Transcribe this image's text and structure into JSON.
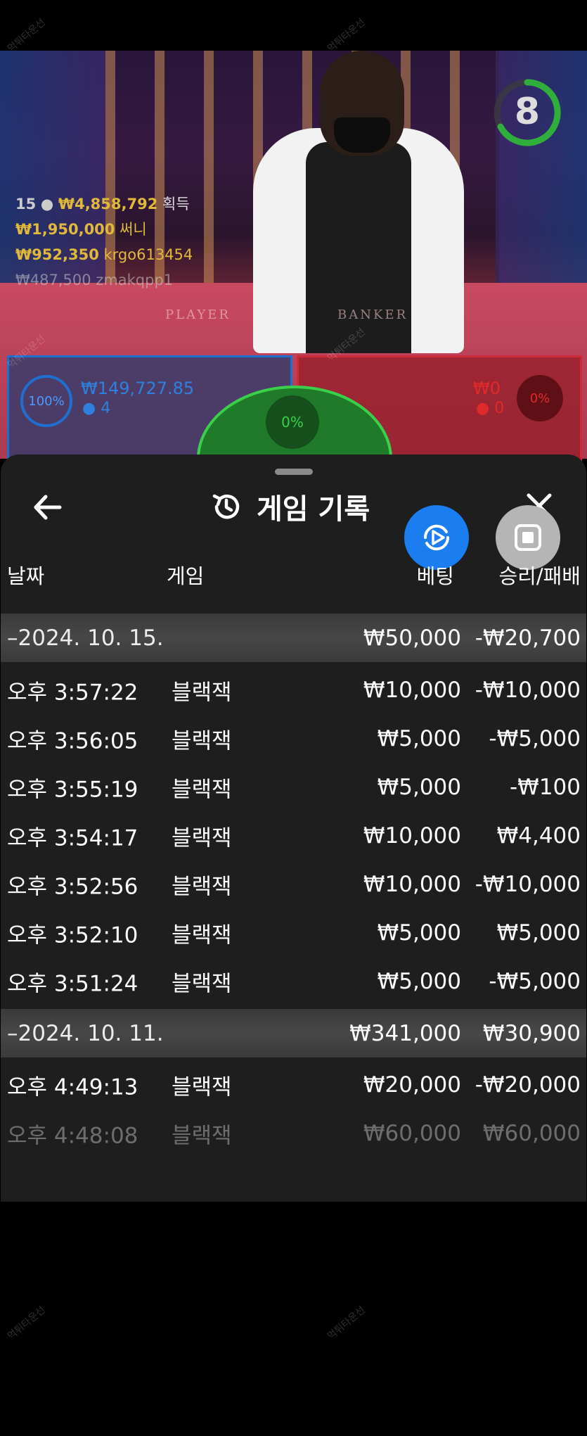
{
  "live": {
    "timer": "8",
    "winners": [
      {
        "rank": "15",
        "amount": "₩4,858,792",
        "name": "획득"
      },
      {
        "amount": "₩1,950,000",
        "name": "써니"
      },
      {
        "amount": "₩952,350",
        "name": "krgo613454"
      },
      {
        "amount": "₩487,500",
        "name": "zmakqpp1"
      }
    ],
    "felt_player": "PLAYER",
    "felt_banker": "BANKER",
    "player": {
      "percent": "100%",
      "amount": "₩149,727.85",
      "count": "4"
    },
    "banker": {
      "percent": "0%",
      "amount": "₩0",
      "count": "0"
    },
    "tie": {
      "percent": "0%"
    },
    "watermark": "먹튀타운선"
  },
  "history": {
    "title": "게임 기록",
    "columns": {
      "date": "날짜",
      "game": "게임",
      "bet": "베팅",
      "result": "승리/패배"
    },
    "rows": [
      {
        "type": "date",
        "date": "–2024. 10. 15.",
        "bet": "₩50,000",
        "result": "-₩20,700"
      },
      {
        "type": "game",
        "date": "오후 3:57:22",
        "game": "블랙잭",
        "bet": "₩10,000",
        "result": "-₩10,000"
      },
      {
        "type": "game",
        "date": "오후 3:56:05",
        "game": "블랙잭",
        "bet": "₩5,000",
        "result": "-₩5,000"
      },
      {
        "type": "game",
        "date": "오후 3:55:19",
        "game": "블랙잭",
        "bet": "₩5,000",
        "result": "-₩100"
      },
      {
        "type": "game",
        "date": "오후 3:54:17",
        "game": "블랙잭",
        "bet": "₩10,000",
        "result": "₩4,400"
      },
      {
        "type": "game",
        "date": "오후 3:52:56",
        "game": "블랙잭",
        "bet": "₩10,000",
        "result": "-₩10,000"
      },
      {
        "type": "game",
        "date": "오후 3:52:10",
        "game": "블랙잭",
        "bet": "₩5,000",
        "result": "₩5,000"
      },
      {
        "type": "game",
        "date": "오후 3:51:24",
        "game": "블랙잭",
        "bet": "₩5,000",
        "result": "-₩5,000"
      },
      {
        "type": "date",
        "date": "–2024. 10. 11.",
        "bet": "₩341,000",
        "result": "₩30,900"
      },
      {
        "type": "game",
        "date": "오후 4:49:13",
        "game": "블랙잭",
        "bet": "₩20,000",
        "result": "-₩20,000"
      },
      {
        "type": "game",
        "date": "오후 4:48:08",
        "game": "블랙잭",
        "bet": "₩60,000",
        "result": "₩60,000"
      }
    ]
  },
  "colors": {
    "accent_blue": "#1a7ef0",
    "gold": "#e0b93a",
    "panel_bg": "#1e1e1e",
    "tie_green": "#3ad04a"
  }
}
